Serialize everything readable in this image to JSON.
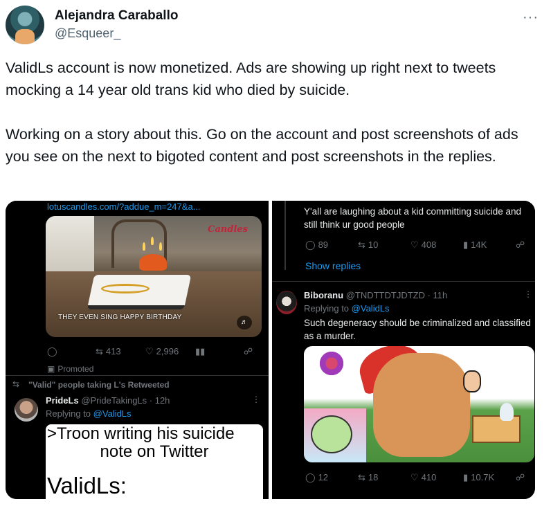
{
  "author": {
    "name": "Alejandra Caraballo",
    "handle": "@Esqueer_"
  },
  "more_label": "···",
  "tweet": {
    "paragraph1": "ValidLs account is now monetized. Ads are showing up right next to tweets mocking a 14 year old trans kid who died by suicide.",
    "paragraph2": "Working on a story about this. Go on the account and post screenshots of ads you see on the next to bigoted content and post screenshots in the replies."
  },
  "left_panel": {
    "ad_link": "lotuscandles.com/?addue_m=247&a...",
    "ad_brand": "Candles",
    "ad_caption": "THEY EVEN SING HAPPY BIRTHDAY",
    "ad_stats": {
      "reposts": "413",
      "likes": "2,996"
    },
    "promoted": "Promoted",
    "retweet_line": "\"Valid\" people taking L's Retweeted",
    "pride_name": "PrideLs",
    "pride_handle": "@PrideTakingLs · 12h",
    "replying_to": "Replying to",
    "replying_handle": "@ValidLs",
    "meme_line1": ">Troon writing his suicide",
    "meme_line2": "note on Twitter",
    "meme_line3": "ValidLs:"
  },
  "right_panel": {
    "top_text": "Y'all are laughing about a kid committing suicide and still think ur good people",
    "top_stats": {
      "replies": "89",
      "reposts": "10",
      "likes": "408",
      "views": "14K"
    },
    "show_replies": "Show replies",
    "bib_name": "Biboranu",
    "bib_handle": "@TNDTTDTJDTZD · 11h",
    "replying_to": "Replying to",
    "replying_handle": "@ValidLs",
    "bib_text": "Such degeneracy should be criminalized and classified as a murder.",
    "bottom_stats": {
      "replies": "12",
      "reposts": "18",
      "likes": "410",
      "views": "10.7K"
    }
  },
  "colors": {
    "link": "#1d9bf0",
    "muted": "#71767b",
    "panel_bg": "#000000"
  },
  "icons": [
    "more-icon",
    "reply-icon",
    "repost-icon",
    "like-icon",
    "views-icon",
    "share-icon",
    "volume-icon",
    "promoted-icon"
  ]
}
